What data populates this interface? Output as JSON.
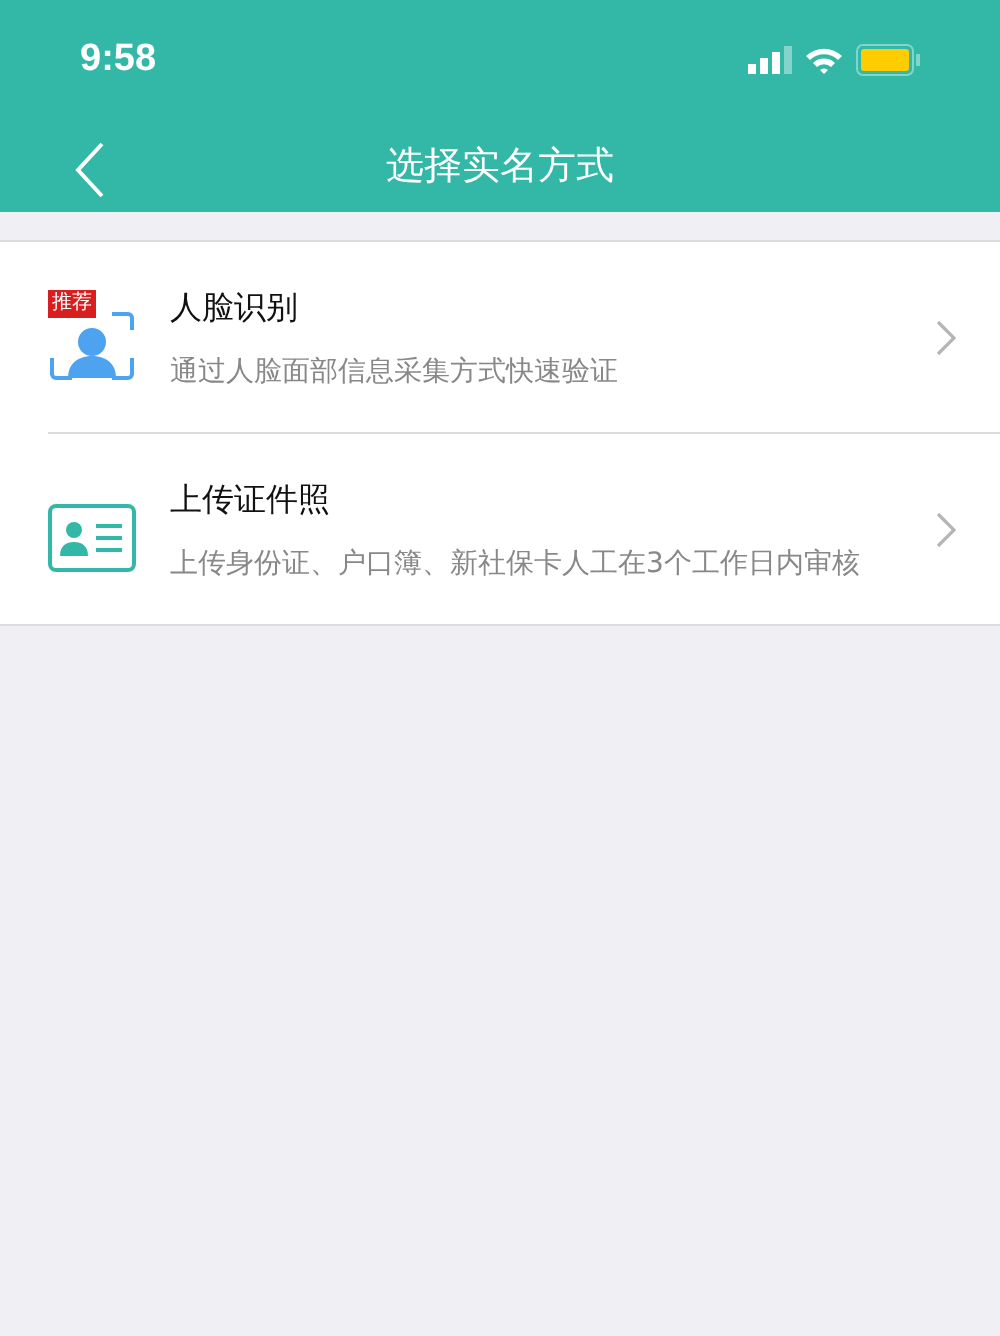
{
  "status_bar": {
    "time": "9:58"
  },
  "nav_bar": {
    "title": "选择实名方式"
  },
  "methods": [
    {
      "kind": "face",
      "badge": "推荐",
      "title": "人脸识别",
      "description": "通过人脸面部信息采集方式快速验证"
    },
    {
      "kind": "id_card",
      "title": "上传证件照",
      "description": "上传身份证、户口簿、新社保卡人工在3个工作日内审核"
    }
  ]
}
